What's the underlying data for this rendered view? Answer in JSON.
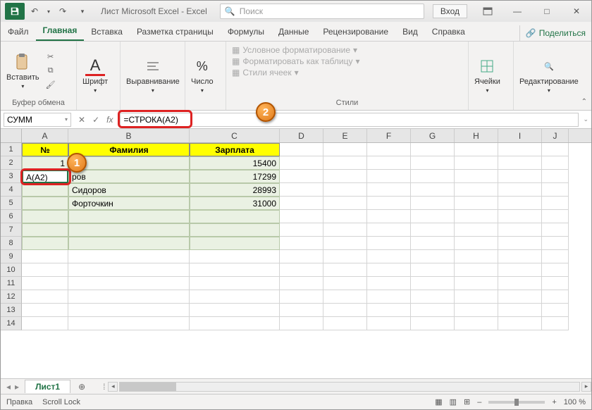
{
  "title": "Лист Microsoft Excel  -  Excel",
  "search_placeholder": "Поиск",
  "signin": "Вход",
  "tabs": [
    "Файл",
    "Главная",
    "Вставка",
    "Разметка страницы",
    "Формулы",
    "Данные",
    "Рецензирование",
    "Вид",
    "Справка"
  ],
  "active_tab": 1,
  "share": "Поделиться",
  "ribbon": {
    "clipboard": {
      "paste": "Вставить",
      "label": "Буфер обмена"
    },
    "font": {
      "btn": "Шрифт",
      "label": "Шрифт"
    },
    "align": {
      "btn": "Выравнивание",
      "label": ""
    },
    "number": {
      "btn": "Число",
      "label": ""
    },
    "styles": {
      "cond": "Условное форматирование",
      "table": "Форматировать как таблицу",
      "cellstyles": "Стили ячеек",
      "label": "Стили"
    },
    "cells": {
      "btn": "Ячейки"
    },
    "editing": {
      "btn": "Редактирование"
    }
  },
  "namebox": "СУММ",
  "formula": "=СТРОКА(A2)",
  "columns": [
    "A",
    "B",
    "C",
    "D",
    "E",
    "F",
    "G",
    "H",
    "I",
    "J"
  ],
  "widths": [
    66,
    172,
    128,
    62,
    62,
    62,
    62,
    62,
    62,
    38
  ],
  "headers": [
    "№",
    "Фамилия",
    "Зарплата"
  ],
  "a2": "1",
  "a3": "А(A2)",
  "namesB": [
    "в",
    "ров",
    "Сидоров",
    "Форточкин"
  ],
  "salaries": [
    "15400",
    "17299",
    "28993",
    "31000"
  ],
  "sheet": "Лист1",
  "status": {
    "mode": "Правка",
    "scroll": "Scroll Lock",
    "zoom": "100 %"
  },
  "callouts": {
    "c1": "1",
    "c2": "2"
  }
}
